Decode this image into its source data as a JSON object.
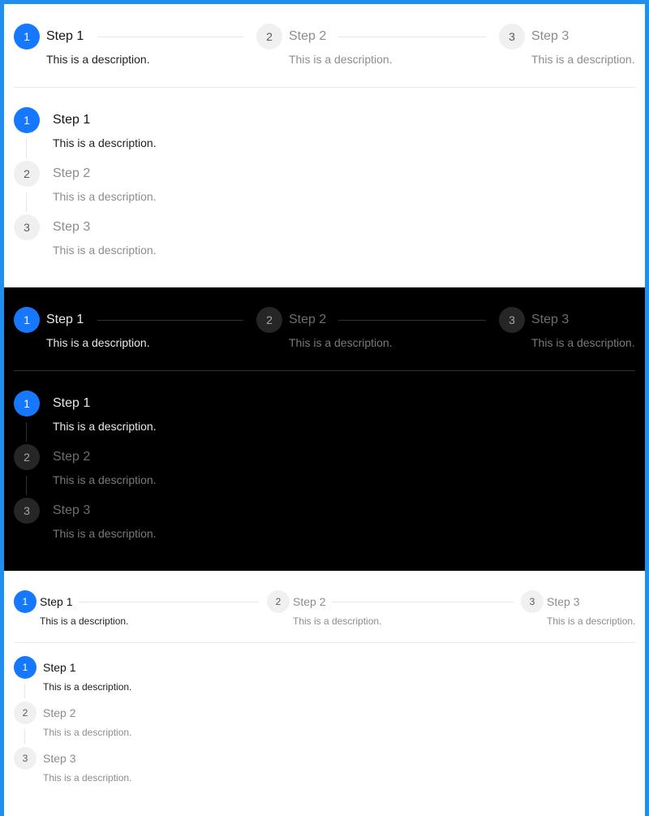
{
  "colors": {
    "frame": "#1f8ff0",
    "primary": "#1677ff",
    "light_bg": "#ffffff",
    "dark_bg": "#000000"
  },
  "light_horizontal": {
    "steps": [
      {
        "number": "1",
        "title": "Step 1",
        "description": "This is a description.",
        "status": "process"
      },
      {
        "number": "2",
        "title": "Step 2",
        "description": "This is a description.",
        "status": "wait"
      },
      {
        "number": "3",
        "title": "Step 3",
        "description": "This is a description.",
        "status": "wait"
      }
    ]
  },
  "light_vertical": {
    "steps": [
      {
        "number": "1",
        "title": "Step 1",
        "description": "This is a description.",
        "status": "process"
      },
      {
        "number": "2",
        "title": "Step 2",
        "description": "This is a description.",
        "status": "wait"
      },
      {
        "number": "3",
        "title": "Step 3",
        "description": "This is a description.",
        "status": "wait"
      }
    ]
  },
  "dark_horizontal": {
    "steps": [
      {
        "number": "1",
        "title": "Step 1",
        "description": "This is a description.",
        "status": "process"
      },
      {
        "number": "2",
        "title": "Step 2",
        "description": "This is a description.",
        "status": "wait"
      },
      {
        "number": "3",
        "title": "Step 3",
        "description": "This is a description.",
        "status": "wait"
      }
    ]
  },
  "dark_vertical": {
    "steps": [
      {
        "number": "1",
        "title": "Step 1",
        "description": "This is a description.",
        "status": "process"
      },
      {
        "number": "2",
        "title": "Step 2",
        "description": "This is a description.",
        "status": "wait"
      },
      {
        "number": "3",
        "title": "Step 3",
        "description": "This is a description.",
        "status": "wait"
      }
    ]
  },
  "small_horizontal": {
    "steps": [
      {
        "number": "1",
        "title": "Step 1",
        "description": "This is a description.",
        "status": "process"
      },
      {
        "number": "2",
        "title": "Step 2",
        "description": "This is a description.",
        "status": "wait"
      },
      {
        "number": "3",
        "title": "Step 3",
        "description": "This is a description.",
        "status": "wait"
      }
    ]
  },
  "small_vertical": {
    "steps": [
      {
        "number": "1",
        "title": "Step 1",
        "description": "This is a description.",
        "status": "process"
      },
      {
        "number": "2",
        "title": "Step 2",
        "description": "This is a description.",
        "status": "wait"
      },
      {
        "number": "3",
        "title": "Step 3",
        "description": "This is a description.",
        "status": "wait"
      }
    ]
  }
}
